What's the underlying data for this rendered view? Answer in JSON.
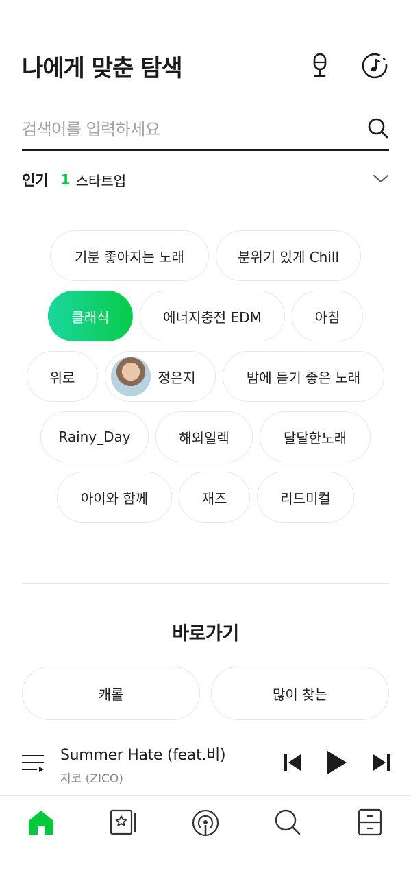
{
  "header": {
    "title": "나에게 맞춘 탐색",
    "icons": [
      "microphone-icon",
      "music-recognition-icon"
    ]
  },
  "search": {
    "placeholder": "검색어를 입력하세요",
    "value": "",
    "icon": "search-icon"
  },
  "popular": {
    "label": "인기",
    "rank": "1",
    "keyword": "스타트업"
  },
  "tags": {
    "row1": [
      "기분 좋아지는 노래",
      "분위기 있게 Chill"
    ],
    "row2": [
      "클래식",
      "에너지충전 EDM",
      "아침"
    ],
    "row3": [
      "위로",
      "정은지",
      "밤에 듣기 좋은 노래"
    ],
    "row4": [
      "Rainy_Day",
      "해외일렉",
      "달달한노래"
    ],
    "row5": [
      "아이와 함께",
      "재즈",
      "리드미컬"
    ],
    "active": "클래식",
    "accent_start": "#1ad6a0",
    "accent_end": "#08cb49"
  },
  "shortcuts": {
    "title": "바로가기",
    "items": [
      "캐롤",
      "많이 찾는"
    ]
  },
  "player": {
    "song": "Summer Hate (feat.비)",
    "artist": "지코 (ZICO)"
  },
  "tabbar": {
    "items": [
      "home-icon",
      "library-icon",
      "podcast-icon",
      "search-icon",
      "storage-icon"
    ],
    "active": "home-icon",
    "active_color": "#06c83b"
  }
}
